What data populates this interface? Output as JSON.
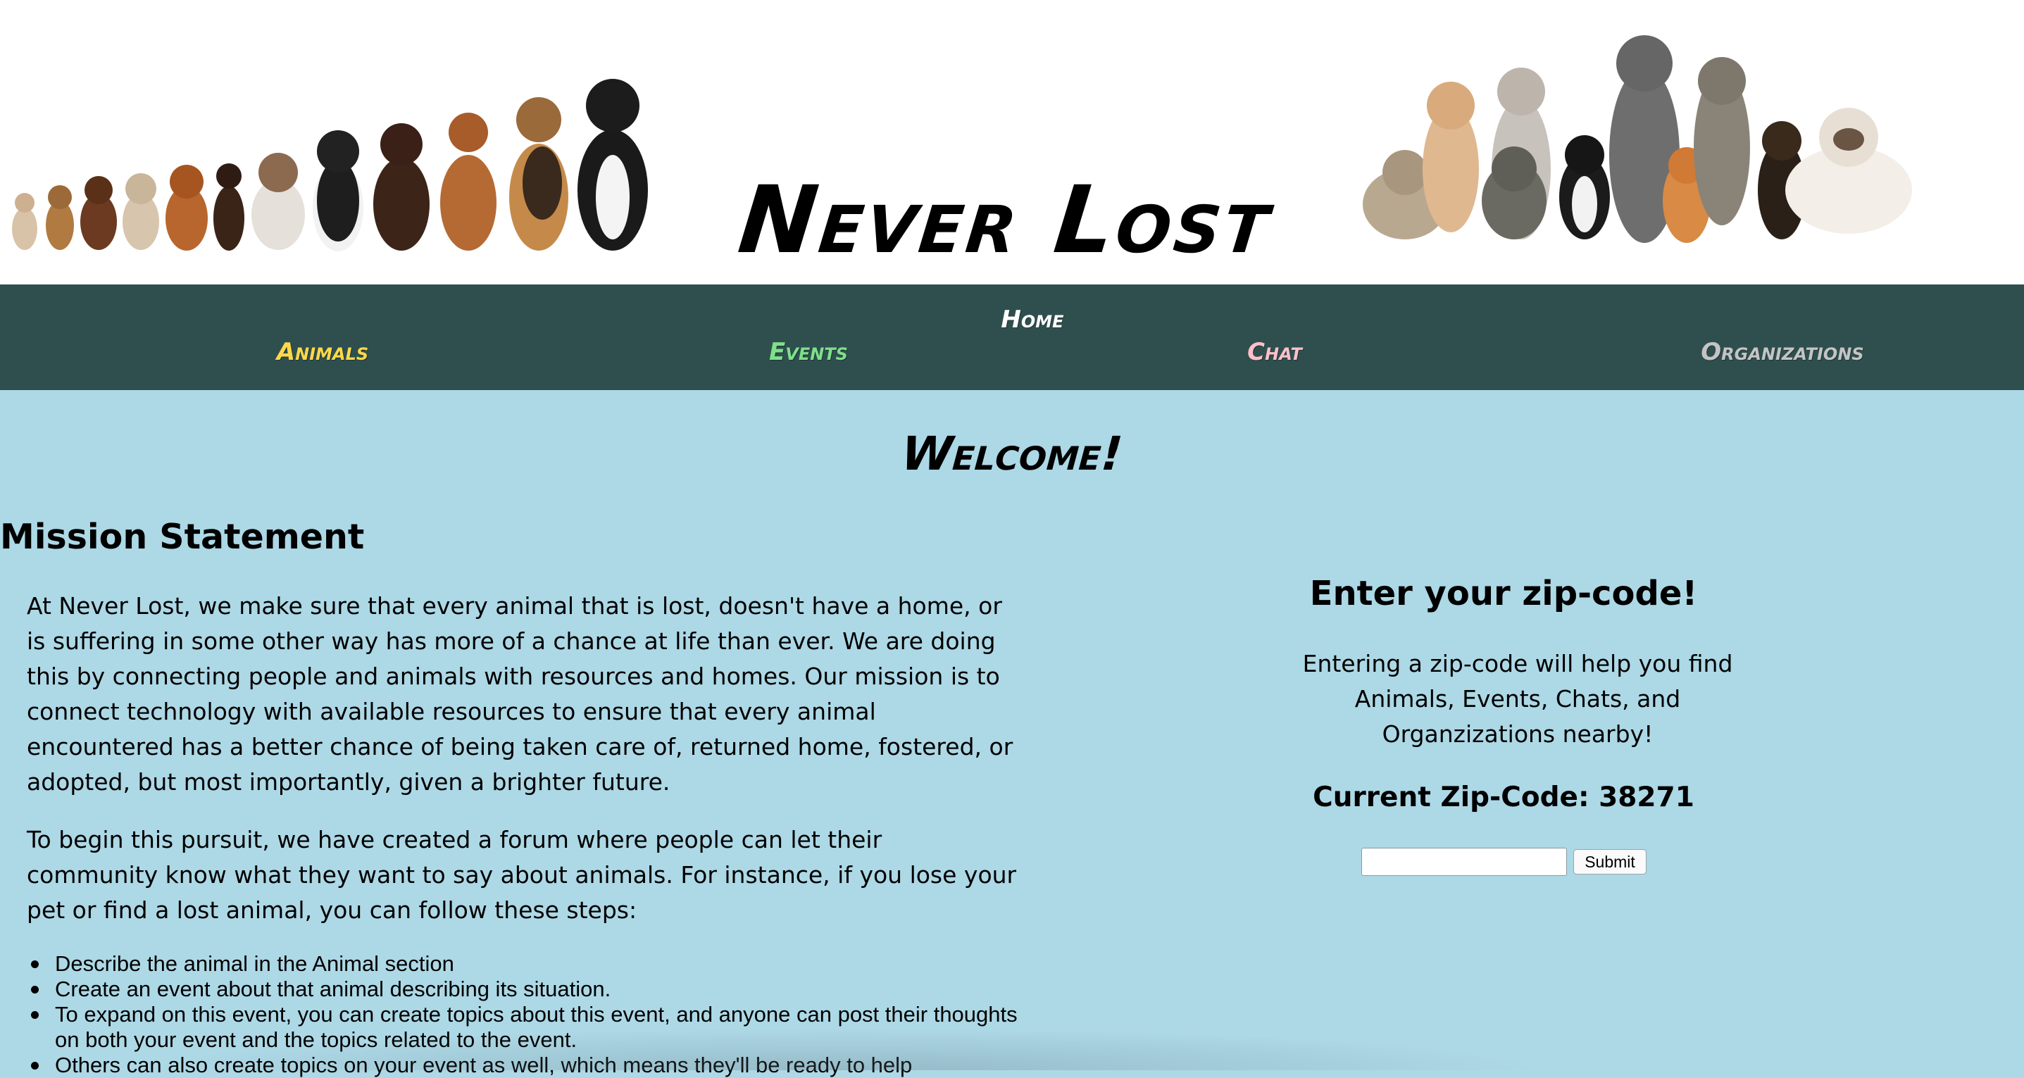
{
  "header": {
    "title": "Never Lost",
    "dogs_image": "group-of-dogs-image",
    "cats_image": "group-of-cats-image"
  },
  "nav": {
    "home": "Home",
    "animals": "Animals",
    "events": "Events",
    "chat": "Chat",
    "organizations": "Organizations",
    "colors": {
      "background": "#2f4f4f",
      "home": "#ffffff",
      "animals": "#ffd84a",
      "events": "#7ee08a",
      "chat": "#ffc0cb",
      "organizations": "#c4c4c4"
    }
  },
  "main": {
    "welcome": "Welcome!",
    "mission_heading": "Mission Statement",
    "mission_p1": "At Never Lost, we make sure that every animal that is lost, doesn't have a home, or is suffering in some other way has more of a chance at life than ever. We are doing this by connecting people and animals with resources and homes. Our mission is to connect technology with available resources to ensure that every animal encountered has a better chance of being taken care of, returned home, fostered, or adopted, but most importantly, given a brighter future.",
    "mission_p2": "To begin this pursuit, we have created a forum where people can let their community know what they want to say about animals. For instance, if you lose your pet or find a lost animal, you can follow these steps:",
    "steps": [
      "Describe the animal in the Animal section",
      "Create an event about that animal describing its situation.",
      "To expand on this event, you can create topics about this event, and anyone can post their thoughts on both your event and the topics related to the event.",
      "Others can also create topics on your event as well, which means they'll be ready to help"
    ],
    "background_color": "#add8e6"
  },
  "zip": {
    "heading": "Enter your zip-code!",
    "help": "Entering a zip-code will help you find Animals, Events, Chats, and Organzizations nearby!",
    "current_label": "Current Zip-Code: 38271",
    "input_value": "",
    "input_placeholder": "",
    "submit_label": "Submit"
  }
}
